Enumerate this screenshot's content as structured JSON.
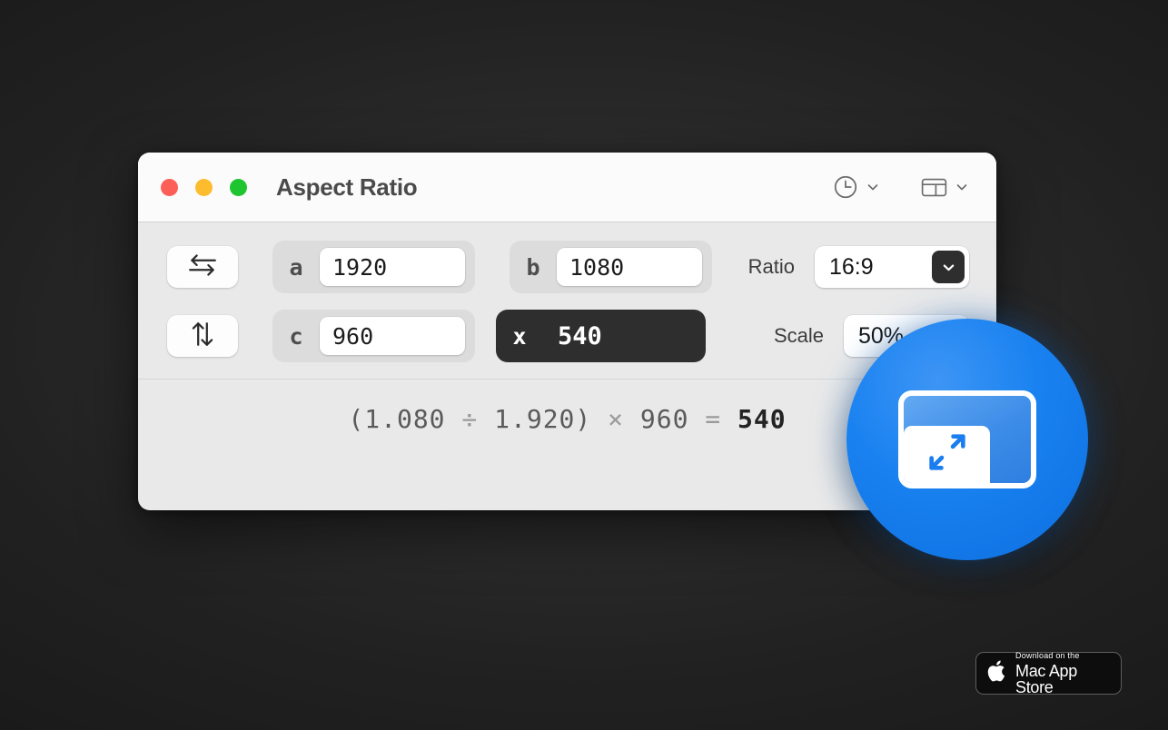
{
  "window": {
    "title": "Aspect Ratio",
    "traffic_lights": [
      {
        "name": "close",
        "color": "#fc5f57"
      },
      {
        "name": "minimize",
        "color": "#fdbc2e"
      },
      {
        "name": "zoom",
        "color": "#1fc52f"
      }
    ],
    "toolbar": [
      {
        "icon": "history-clock-icon",
        "chevron": "chevron-down-icon"
      },
      {
        "icon": "layout-panel-icon",
        "chevron": "chevron-down-icon"
      }
    ]
  },
  "controls": {
    "row1": {
      "swap_icon": "swap-horizontal-icon",
      "field_a": {
        "label": "a",
        "value": "1920",
        "placeholder": "a"
      },
      "field_b": {
        "label": "b",
        "value": "1080",
        "placeholder": "b"
      },
      "side": {
        "label": "Ratio",
        "value": "16:9",
        "chevron": "chevron-down-icon"
      }
    },
    "row2": {
      "swap_icon": "swap-vertical-icon",
      "field_c": {
        "label": "c",
        "value": "960",
        "placeholder": "c"
      },
      "result": {
        "label": "x",
        "value": "540"
      },
      "side": {
        "label": "Scale",
        "value": "50%"
      }
    }
  },
  "formula": {
    "open_paren": "(",
    "numerator": "1.080",
    "divide": " ÷ ",
    "denominator": "1.920",
    "close_paren": ")",
    "times": " × ",
    "multiplier": "960",
    "equals": " = ",
    "result": "540",
    "full": "(1.080 ÷ 1.920) × 960 = 540"
  },
  "app_icon": {
    "name": "aspect-ratio-app-icon",
    "background_color": "#1a82f0",
    "glyph": "resize-diagonal-arrows"
  },
  "badge": {
    "logo": "apple-logo-icon",
    "subtitle": "Download on the",
    "title": "Mac App Store"
  },
  "theme": {
    "backdrop": "#1c1c1c",
    "titlebar": "#fbfbfb",
    "window_body": "#e9e9e9",
    "field_group": "#dcdcdc",
    "accent_dark": "#2e2e2e",
    "accent_blue": "#1a82f0"
  }
}
